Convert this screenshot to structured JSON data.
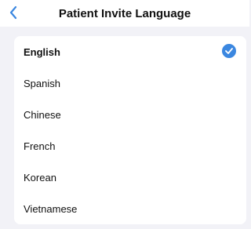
{
  "header": {
    "title": "Patient Invite Language",
    "back_icon": "chevron-left-icon"
  },
  "languages": [
    {
      "label": "English",
      "selected": true
    },
    {
      "label": "Spanish",
      "selected": false
    },
    {
      "label": "Chinese",
      "selected": false
    },
    {
      "label": "French",
      "selected": false
    },
    {
      "label": "Korean",
      "selected": false
    },
    {
      "label": "Vietnamese",
      "selected": false
    }
  ],
  "selected_icon": "checkmark-circle-icon",
  "colors": {
    "accent": "#3b87e0",
    "background": "#f2f2f7",
    "card": "#ffffff",
    "text": "#111111"
  }
}
